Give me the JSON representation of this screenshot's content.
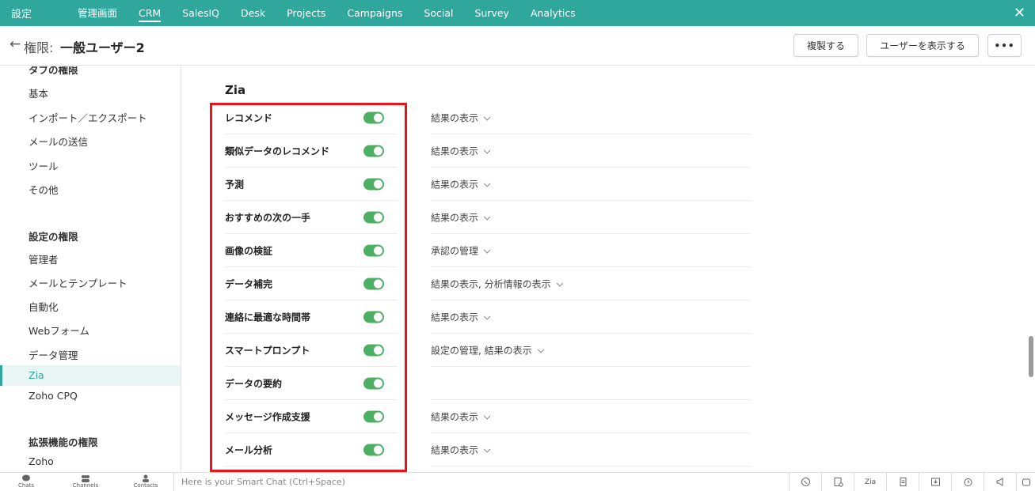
{
  "topbar": {
    "settings": "設定",
    "nav": [
      "管理画面",
      "CRM",
      "SalesIQ",
      "Desk",
      "Projects",
      "Campaigns",
      "Social",
      "Survey",
      "Analytics"
    ],
    "active": "CRM",
    "close_icon": "close-icon"
  },
  "header": {
    "back_icon": "←",
    "title_prefix": "権限: ",
    "title": "一般ユーザー2",
    "duplicate_label": "複製する",
    "show_users_label": "ユーザーを表示する",
    "more_label": "•••"
  },
  "sidebar": {
    "top_cut_heading": "タブの権限",
    "tab_items": [
      "基本",
      "インポート／エクスポート",
      "メールの送信",
      "ツール",
      "その他"
    ],
    "settings_heading": "設定の権限",
    "settings_items": [
      "管理者",
      "メールとテンプレート",
      "自動化",
      "Webフォーム",
      "データ管理",
      "Zia",
      "Zoho CPQ"
    ],
    "active_item": "Zia",
    "extension_heading": "拡張機能の権限",
    "extension_items": [
      "Zoho"
    ]
  },
  "main": {
    "section_title": "Zia",
    "rows": [
      {
        "label": "レコメンド",
        "enabled": true,
        "permission": "結果の表示"
      },
      {
        "label": "類似データのレコメンド",
        "enabled": true,
        "permission": "結果の表示"
      },
      {
        "label": "予測",
        "enabled": true,
        "permission": "結果の表示"
      },
      {
        "label": "おすすめの次の一手",
        "enabled": true,
        "permission": "結果の表示"
      },
      {
        "label": "画像の検証",
        "enabled": true,
        "permission": "承認の管理"
      },
      {
        "label": "データ補完",
        "enabled": true,
        "permission": "結果の表示, 分析情報の表示"
      },
      {
        "label": "連絡に最適な時間帯",
        "enabled": true,
        "permission": "結果の表示"
      },
      {
        "label": "スマートプロンプト",
        "enabled": true,
        "permission": "設定の管理, 結果の表示"
      },
      {
        "label": "データの要約",
        "enabled": true,
        "permission": ""
      },
      {
        "label": "メッセージ作成支援",
        "enabled": true,
        "permission": "結果の表示"
      },
      {
        "label": "メール分析",
        "enabled": true,
        "permission": "結果の表示"
      }
    ]
  },
  "bottombar": {
    "chats": "Chats",
    "channels": "Channels",
    "contacts": "Contacts",
    "smartchat_placeholder": "Here is your Smart Chat (Ctrl+Space)"
  },
  "colors": {
    "topbar": "#2fa79c",
    "toggle_on": "#4caf63",
    "highlight": "#e8131b"
  }
}
